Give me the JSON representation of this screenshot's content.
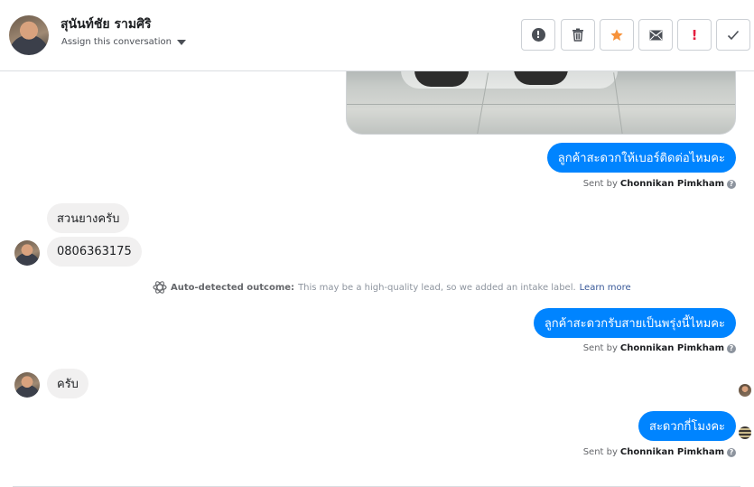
{
  "header": {
    "contact_name": "สุนันท์ชัย รามศิริ",
    "assign_label": "Assign this conversation"
  },
  "toolbar": {
    "buttons": [
      {
        "name": "mark-spam-button",
        "icon": "exclamation-circle-icon",
        "glyph": "!"
      },
      {
        "name": "delete-button",
        "icon": "trash-icon"
      },
      {
        "name": "star-button",
        "icon": "star-icon",
        "color": "#f7923a"
      },
      {
        "name": "mark-unread-button",
        "icon": "envelope-icon"
      },
      {
        "name": "follow-up-button",
        "icon": "red-exclamation-icon",
        "glyph": "!",
        "color": "#e41e3f"
      },
      {
        "name": "mark-done-button",
        "icon": "checkmark-icon"
      }
    ]
  },
  "messages": [
    {
      "direction": "out",
      "text": "ลูกค้าสะดวกให้เบอร์ติดต่อไหมคะ",
      "sent_by_prefix": "Sent by",
      "sent_by": "Chonnikan Pimkham"
    },
    {
      "direction": "in",
      "text": "สวนยางครับ"
    },
    {
      "direction": "in",
      "text": "0806363175"
    },
    {
      "direction": "out",
      "text": "ลูกค้าสะดวกรับสายเป็นพรุ่งนี้ไหมคะ",
      "sent_by_prefix": "Sent by",
      "sent_by": "Chonnikan Pimkham"
    },
    {
      "direction": "in",
      "text": "ครับ"
    },
    {
      "direction": "out",
      "text": "สะดวกกี่โมงคะ",
      "sent_by_prefix": "Sent by",
      "sent_by": "Chonnikan Pimkham"
    }
  ],
  "auto_detected": {
    "label": "Auto-detected outcome:",
    "text": "This may be a high-quality lead, so we added an intake label.",
    "link": "Learn more"
  },
  "colors": {
    "accent": "#0084ff",
    "incoming_bubble": "#f1f0f0"
  }
}
